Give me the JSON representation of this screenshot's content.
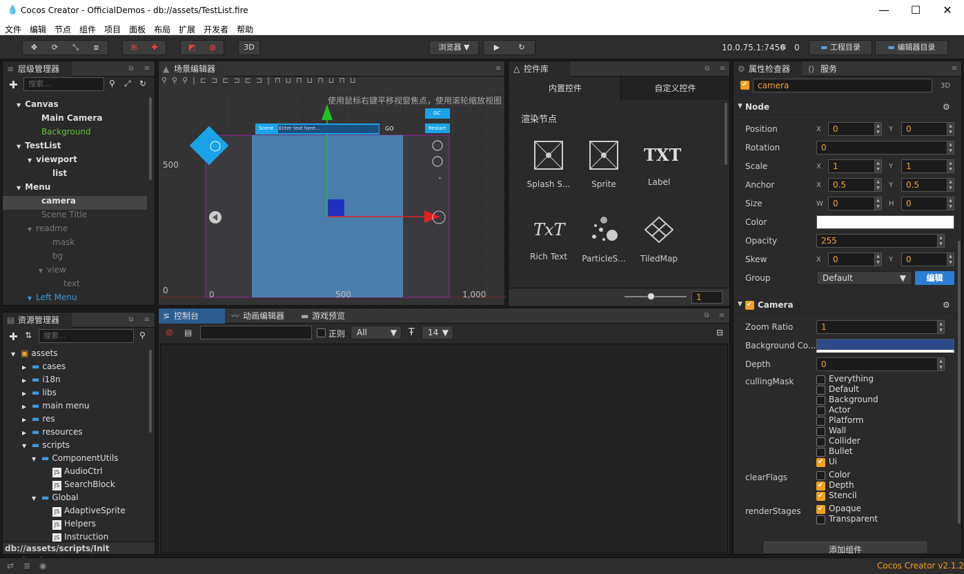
{
  "title": "Cocos Creator - OfficialDemos - db://assets/TestList.fire",
  "menu": [
    "文件",
    "编辑",
    "节点",
    "组件",
    "项目",
    "面板",
    "布局",
    "扩展",
    "开发者",
    "帮助"
  ],
  "toolbar": {
    "three_d": "3D",
    "browser": "浏览器 ▼",
    "ip": "10.0.75.1:7456",
    "wifi_count": "0",
    "project_dir": "工程目录",
    "editor_dir": "编辑器目录"
  },
  "hierarchy": {
    "title": "层级管理器",
    "search_placeholder": "搜索...",
    "items": [
      {
        "label": "Canvas",
        "arrow": "▼",
        "color": "#ddd",
        "bold": true
      },
      {
        "label": "Main Camera",
        "arrow": "",
        "color": "#ddd",
        "bold": true
      },
      {
        "label": "Background",
        "arrow": "",
        "color": "#5fc23a",
        "bold": false
      },
      {
        "label": "TestList",
        "arrow": "▼",
        "color": "#ddd",
        "bold": true
      },
      {
        "label": "viewport",
        "arrow": "▼",
        "color": "#ddd",
        "bold": true
      },
      {
        "label": "list",
        "arrow": "",
        "color": "#ddd",
        "bold": true
      },
      {
        "label": "Menu",
        "arrow": "▼",
        "color": "#ddd",
        "bold": true
      },
      {
        "label": "camera",
        "arrow": "",
        "color": "#ddd",
        "bold": true
      },
      {
        "label": "Scene Title",
        "arrow": "",
        "color": "#777",
        "bold": false
      },
      {
        "label": "readme",
        "arrow": "▼",
        "color": "#777",
        "bold": false
      },
      {
        "label": "mask",
        "arrow": "",
        "color": "#777",
        "bold": false
      },
      {
        "label": "bg",
        "arrow": "",
        "color": "#777",
        "bold": false
      },
      {
        "label": "view",
        "arrow": "▼",
        "color": "#777",
        "bold": false
      },
      {
        "label": "text",
        "arrow": "",
        "color": "#777",
        "bold": false
      },
      {
        "label": "Left Menu",
        "arrow": "▼",
        "color": "#3a9ae0",
        "bold": false
      }
    ]
  },
  "scene": {
    "title": "场景编辑器",
    "hint": "使用鼠标右键平移视窗焦点，使用滚轮缩放视图",
    "ruler_500": "500",
    "ruler_0": "0",
    "x_0": "0",
    "x_500": "500",
    "x_1000": "1,000",
    "gc": "GC",
    "restart": "Restart",
    "scene_label": "Scene",
    "scene_input": "Enter text here...",
    "go": "GO"
  },
  "widgets": {
    "title": "控件库",
    "tab_builtin": "内置控件",
    "tab_custom": "自定义控件",
    "section": "渲染节点",
    "items": [
      "Splash S...",
      "Sprite",
      "Label",
      "Rich Text",
      "ParticleS...",
      "TiledMap"
    ],
    "icon_names": [
      "splash-sprite-icon",
      "sprite-icon",
      "label-icon",
      "rich-text-icon",
      "particle-system-icon",
      "tiledmap-icon"
    ],
    "zoom": "1"
  },
  "assets": {
    "title": "资源管理器",
    "search_placeholder": "搜索...",
    "items": [
      {
        "label": "assets",
        "type": "root"
      },
      {
        "label": "cases",
        "type": "folder"
      },
      {
        "label": "i18n",
        "type": "folder"
      },
      {
        "label": "libs",
        "type": "folder"
      },
      {
        "label": "main menu",
        "type": "folder"
      },
      {
        "label": "res",
        "type": "folder"
      },
      {
        "label": "resources",
        "type": "folder"
      },
      {
        "label": "scripts",
        "type": "folder-open"
      },
      {
        "label": "ComponentUtils",
        "type": "folder-open"
      },
      {
        "label": "AudioCtrl",
        "type": "js"
      },
      {
        "label": "SearchBlock",
        "type": "js"
      },
      {
        "label": "Global",
        "type": "folder-open"
      },
      {
        "label": "AdaptiveSprite",
        "type": "js"
      },
      {
        "label": "Helpers",
        "type": "js"
      },
      {
        "label": "Instruction",
        "type": "js"
      }
    ],
    "path": "db://assets/scripts/Init Engine.js"
  },
  "console": {
    "tabs": [
      "控制台",
      "动画编辑器",
      "游戏预览"
    ],
    "regex": "正则",
    "level": "All",
    "font_size": "14"
  },
  "inspector": {
    "tabs": [
      "属性检查器",
      "服务"
    ],
    "node_name": "camera",
    "three_d": "3D",
    "node_section": "Node",
    "camera_section": "Camera",
    "labels": {
      "position": "Position",
      "rotation": "Rotation",
      "scale": "Scale",
      "anchor": "Anchor",
      "size": "Size",
      "color": "Color",
      "opacity": "Opacity",
      "skew": "Skew",
      "group": "Group",
      "zoom": "Zoom Ratio",
      "bg": "Background Co...",
      "depth": "Depth",
      "culling": "cullingMask",
      "clear": "clearFlags",
      "render": "renderStages"
    },
    "values": {
      "pos_x": "0",
      "pos_y": "0",
      "rotation": "0",
      "scale_x": "1",
      "scale_y": "1",
      "anchor_x": "0.5",
      "anchor_y": "0.5",
      "size_w": "0",
      "size_h": "0",
      "opacity": "255",
      "skew_x": "0",
      "skew_y": "0",
      "group": "Default",
      "zoom": "1",
      "depth": "0"
    },
    "axis": {
      "x": "X",
      "y": "Y",
      "w": "W",
      "h": "H"
    },
    "edit": "编辑",
    "culling_mask": [
      {
        "label": "Everything",
        "on": false
      },
      {
        "label": "Default",
        "on": false
      },
      {
        "label": "Background",
        "on": false
      },
      {
        "label": "Actor",
        "on": false
      },
      {
        "label": "Platform",
        "on": false
      },
      {
        "label": "Wall",
        "on": false
      },
      {
        "label": "Collider",
        "on": false
      },
      {
        "label": "Bullet",
        "on": false
      },
      {
        "label": "Ui",
        "on": true
      }
    ],
    "clear_flags": [
      {
        "label": "Color",
        "on": false
      },
      {
        "label": "Depth",
        "on": true
      },
      {
        "label": "Stencil",
        "on": true
      }
    ],
    "render_stages": [
      {
        "label": "Opaque",
        "on": true
      },
      {
        "label": "Transparent",
        "on": false
      }
    ],
    "add_component": "添加组件"
  },
  "status": {
    "version": "Cocos Creator v2.1.2"
  },
  "colors": {
    "accent": "#f2a01e",
    "blue": "#2c7dd3",
    "bg_color": "#2d4a8a"
  }
}
